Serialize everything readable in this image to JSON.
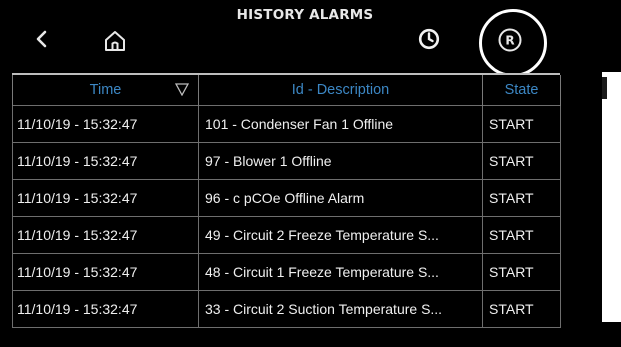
{
  "header": {
    "title": "HISTORY ALARMS",
    "back_icon": "chevron-left-icon",
    "home_icon": "home-icon",
    "history_icon": "clock-icon",
    "reset_icon": "reset-r-icon"
  },
  "table": {
    "columns": {
      "time": "Time",
      "description": "Id - Description",
      "state": "State"
    },
    "rows": [
      {
        "time": "11/10/19 - 15:32:47",
        "description": "101 - Condenser Fan 1 Offline",
        "state": "START"
      },
      {
        "time": "11/10/19 - 15:32:47",
        "description": "97 - Blower 1 Offline",
        "state": "START"
      },
      {
        "time": "11/10/19 - 15:32:47",
        "description": "96 - c pCOe Offline Alarm",
        "state": "START"
      },
      {
        "time": "11/10/19 - 15:32:47",
        "description": "49 - Circuit 2 Freeze Temperature S...",
        "state": "START"
      },
      {
        "time": "11/10/19 - 15:32:47",
        "description": "48 - Circuit 1 Freeze Temperature S...",
        "state": "START"
      },
      {
        "time": "11/10/19 - 15:32:47",
        "description": "33 - Circuit 2 Suction Temperature S...",
        "state": "START"
      }
    ]
  },
  "colors": {
    "background": "#000000",
    "header_text": "#3c87c4",
    "cell_text": "#f0f0f0",
    "highlight_ring": "#ffffff"
  }
}
